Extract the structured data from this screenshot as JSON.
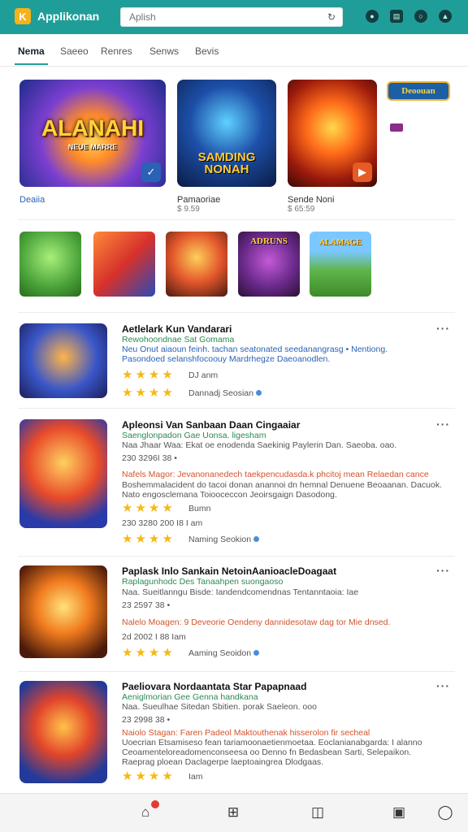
{
  "app": {
    "logo_letter": "K",
    "name": "Applikonan"
  },
  "search": {
    "placeholder": "Aplish"
  },
  "tabs": [
    "Nema",
    "Saeeo",
    "Renres",
    "Senws",
    "Bevis"
  ],
  "featured": [
    {
      "art_text": "ALANAHI",
      "art_sub": "NEUE MARRE",
      "caption": "Deaiia",
      "sub": ""
    },
    {
      "art_text": "SAMDING NONAH",
      "art_sub": "",
      "caption": "Pamaoriae",
      "sub": "$ 9.59"
    },
    {
      "art_text": "",
      "art_sub": "",
      "caption": "Sende Noni",
      "sub": "$ 65:59"
    }
  ],
  "promo": {
    "label": "Deoouan"
  },
  "mini_art": [
    "",
    "",
    "",
    "ADRUNS",
    "ALAMAGE"
  ],
  "list": [
    {
      "title": "Aetlelark Kun Vandarari",
      "lines": [
        {
          "cls": "green",
          "text": "Rewohoondnae Sat Gomama"
        },
        {
          "cls": "blue",
          "text": "Neu Onut aiaoun feinh. tachan seatonated seedanangrasg • Nentiong."
        },
        {
          "cls": "blue",
          "text": "Pasondoed selanshfocoouy Mardrhegze Daeoanodlen."
        }
      ],
      "stars_a": "★★★★",
      "stars_a_txt": "DJ anm",
      "stars_b": "★★★★",
      "stars_b_txt": "Dannadj Seosian"
    },
    {
      "title": "Apleonsi Van Sanbaan Daan Cingaaiar",
      "lines": [
        {
          "cls": "green",
          "text": "Saenglonpadon Gae Uonsa. ligesham"
        },
        {
          "cls": "gray",
          "text": "Naa Jhaar Waa: Ekat oe enodenda Saekinig Paylerin Dan. Saeoba. oao."
        },
        {
          "cls": "gray",
          "text": "230 3296I 38 •"
        },
        {
          "cls": "orange",
          "text": "Nafels Magor: Jevanonanedech taekpencudasda.k phcitoj mean Relaedan cance"
        },
        {
          "cls": "gray",
          "text": "Boshemmalacident do tacoi donan anannoi dn hemnal Denuene Beoaanan. Dacuok."
        },
        {
          "cls": "gray",
          "text": "Nato engosclemana Toiooceccon Jeoirsgaign Dasodong."
        },
        {
          "cls": "gray",
          "text": "230 3280 200 I8 I am"
        }
      ],
      "stars_a": "★★★★",
      "stars_a_txt": "Bumn",
      "stars_b": "★★★★",
      "stars_b_txt": "Naming Seokion"
    },
    {
      "title": "Paplask Inlo Sankain NetoinAanioacleDoagaat",
      "lines": [
        {
          "cls": "green",
          "text": "Raplagunhodc Des Tanaahpen suongaoso"
        },
        {
          "cls": "gray",
          "text": "Naa. Sueitlanngu Bisde: Iandendcomendnas Tentanntaoia: Iae"
        },
        {
          "cls": "gray",
          "text": "23 2597 38 •"
        },
        {
          "cls": "orange",
          "text": "Nalelo Moagen: 9 Deveorie Oendeny dannidesotaw dag tor Mie dnsed."
        },
        {
          "cls": "gray",
          "text": "2d 2002 I 88 Iam"
        }
      ],
      "stars_a": "★★★★",
      "stars_a_txt": "Aaming Seoidon",
      "stars_b": "",
      "stars_b_txt": ""
    },
    {
      "title": "Paeliovara Nordaantata Star Papapnaad",
      "lines": [
        {
          "cls": "green",
          "text": "Aeniglmorian Gee Genna handkana"
        },
        {
          "cls": "gray",
          "text": "Naa. Sueulhae Sitedan Sbitien. porak Saeleon. ooo"
        },
        {
          "cls": "gray",
          "text": "23 2998 38 •"
        },
        {
          "cls": "orange",
          "text": "Naiolo Stagan: Faren Padeol Maktouthenak hisserolon fir secheal"
        },
        {
          "cls": "gray",
          "text": "Uoecrian Etsamiseso fean tariamoonaetienmoetaa. Eoclanianabgarda: I alanno"
        },
        {
          "cls": "gray",
          "text": "Ceoamenteloreadomenconseesa oo Denno fn Bedasbean Sarti, Selepaikon."
        },
        {
          "cls": "gray",
          "text": "Raeprag ploean Daclagerpe laeptoaingrea Dlodgaas."
        }
      ],
      "stars_a": "★★★★",
      "stars_a_txt": "Iam",
      "stars_b": "",
      "stars_b_txt": ""
    }
  ],
  "colors": {
    "accent": "#1f9e99",
    "star": "#f5b915",
    "link": "#2a62b5"
  }
}
